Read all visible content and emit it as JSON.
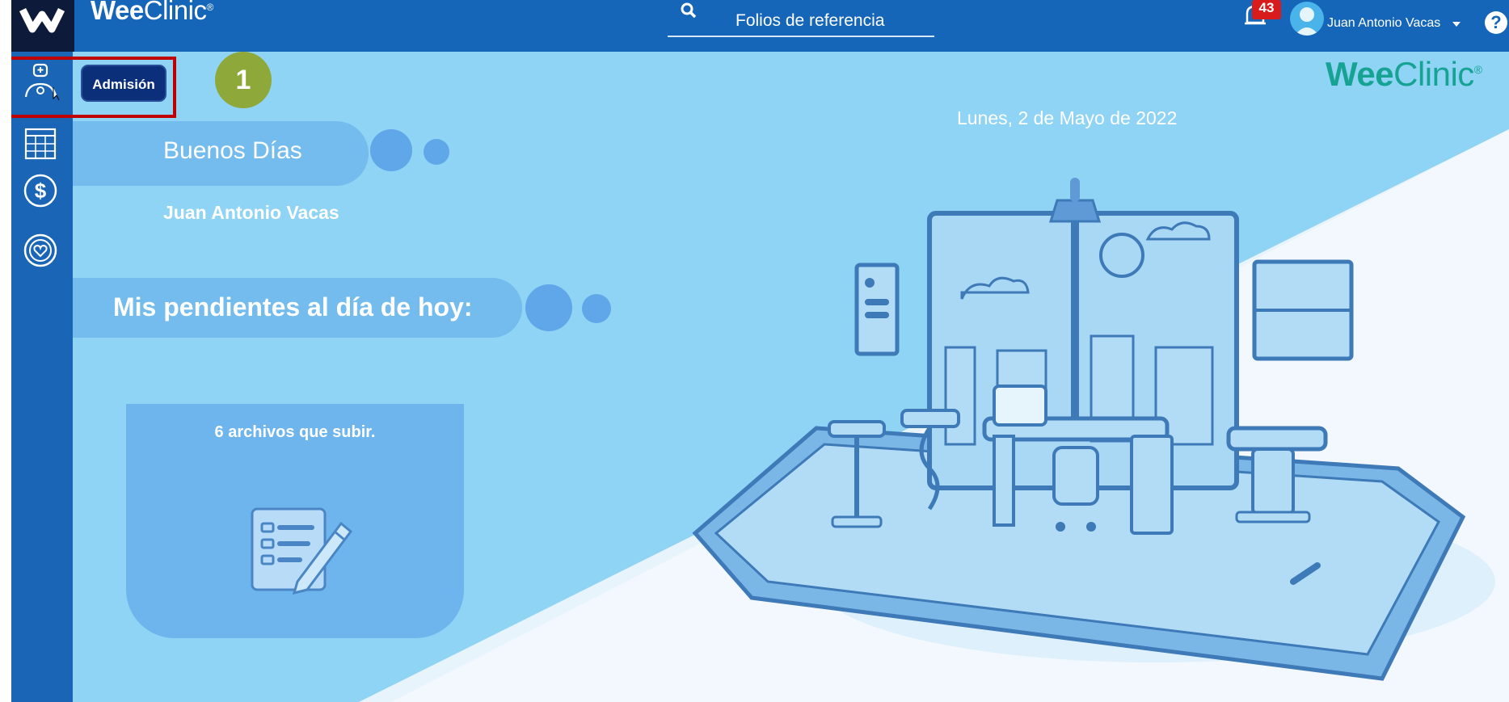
{
  "app": {
    "brand": "WeeClinic",
    "brand_prefix": "Wee",
    "brand_suffix": "Clinic",
    "reg_mark": "®"
  },
  "header": {
    "search_label": "Folios de referencia",
    "notifications_count": "43",
    "user_name": "Juan Antonio Vacas",
    "help_label": "?"
  },
  "sidebar": {
    "items": [
      {
        "icon": "doctor-icon",
        "tooltip": "Admisión"
      },
      {
        "icon": "calendar-icon"
      },
      {
        "icon": "dollar-icon"
      },
      {
        "icon": "heart-ring-icon"
      }
    ]
  },
  "annotation": {
    "step": "1"
  },
  "main": {
    "date": "Lunes, 2 de Mayo de 2022",
    "greeting": "Buenos Días",
    "user_name": "Juan Antonio Vacas",
    "pending_title": "Mis pendientes al día de hoy:",
    "card_text": "6 archivos que subir."
  },
  "colors": {
    "topbar": "#1565b8",
    "sidebar": "#1a65b5",
    "background": "#8fd3f5",
    "brand_teal": "#16a394",
    "highlight": "#c00000",
    "step_badge": "#8fa83a"
  }
}
